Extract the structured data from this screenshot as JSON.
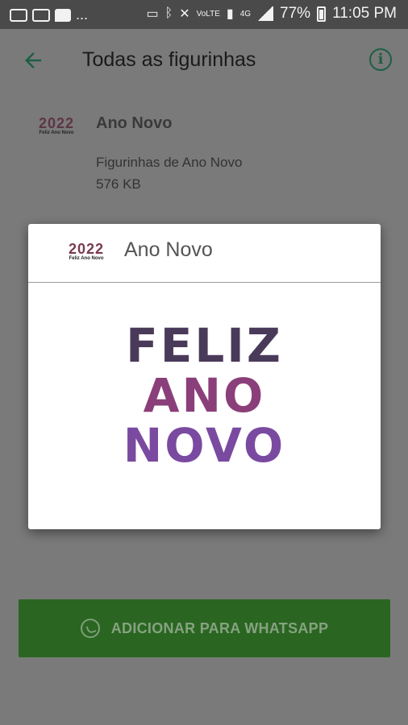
{
  "status_bar": {
    "overflow": "...",
    "network": "4G",
    "battery": "77%",
    "time": "11:05 PM",
    "icons": [
      "cast-icon",
      "bluetooth-icon",
      "mute-icon",
      "volte-icon",
      "sim-icon",
      "signal-icon",
      "battery-icon"
    ]
  },
  "appbar": {
    "title": "Todas as figurinhas"
  },
  "pack": {
    "thumb_year": "2022",
    "thumb_sub": "Feliz Ano Novo",
    "name": "Ano Novo",
    "description": "Figurinhas de Ano Novo",
    "size": "576 KB"
  },
  "dialog": {
    "thumb_year": "2022",
    "thumb_sub": "Feliz Ano Novo",
    "title": "Ano Novo",
    "sticker_lines": [
      "FELIZ",
      "ANO",
      "NOVO"
    ]
  },
  "add_button": {
    "label": "ADICIONAR PARA WHATSAPP"
  },
  "colors": {
    "primary": "#1c5e44",
    "button": "#2a6621",
    "overlay": "#7a7a7a"
  }
}
